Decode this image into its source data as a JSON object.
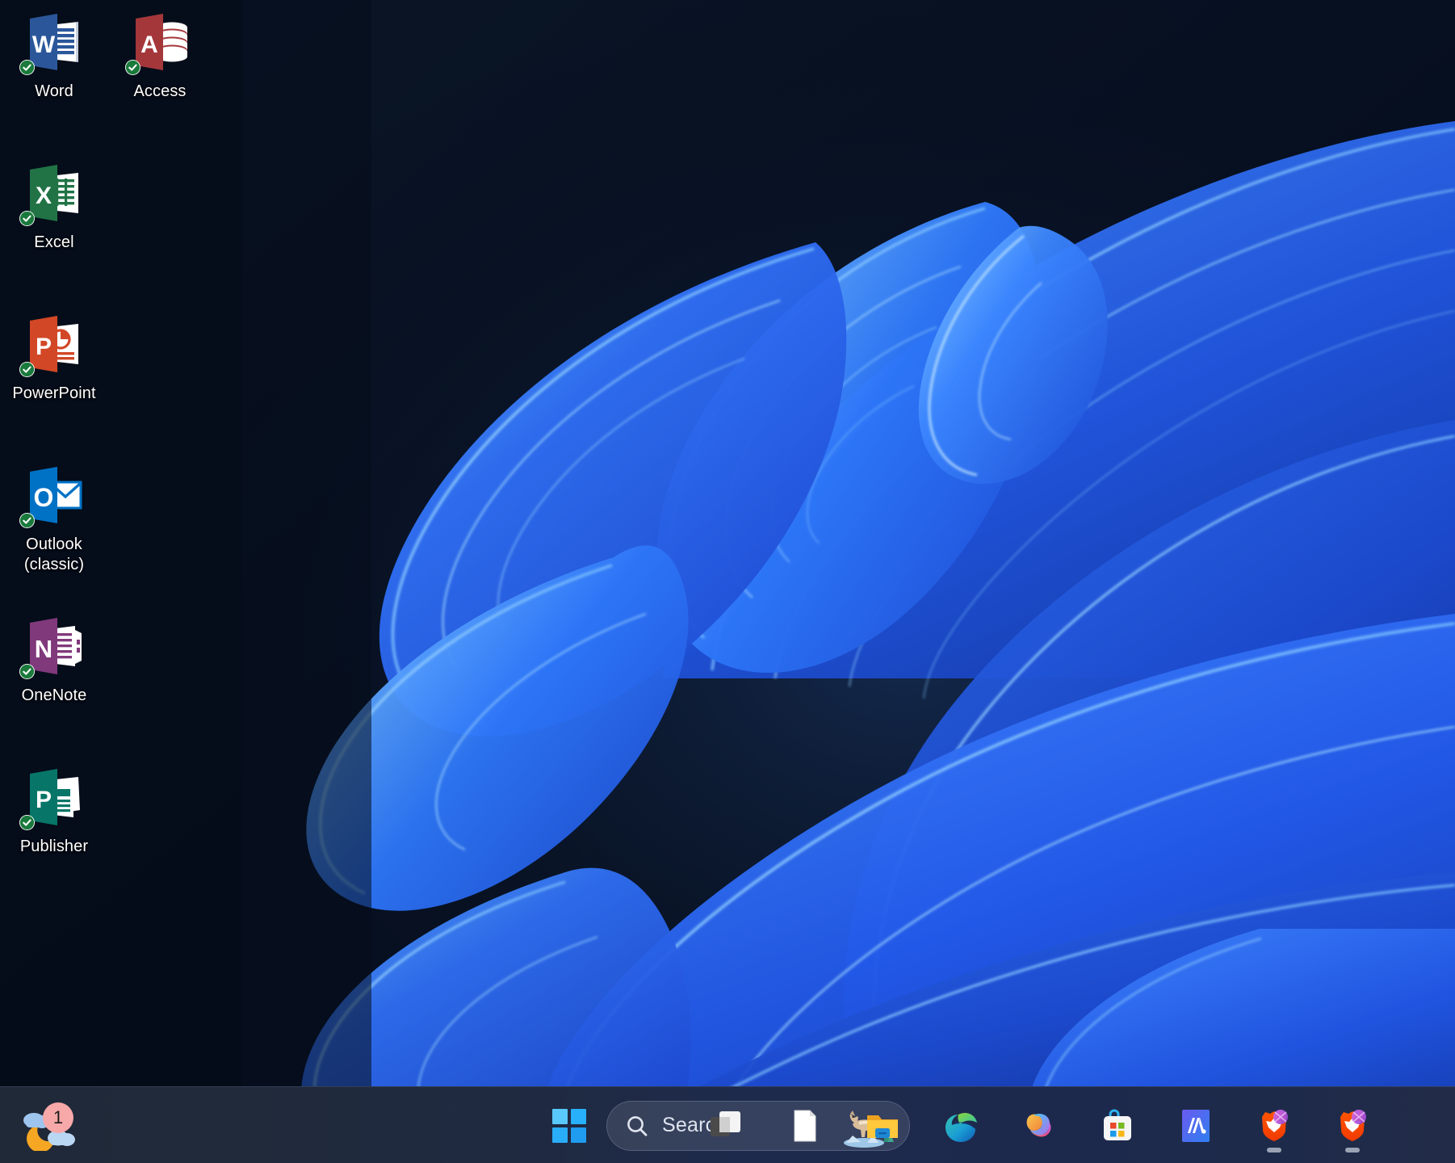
{
  "os": "Windows 11",
  "wallpaper": {
    "name": "Windows 11 Bloom",
    "background_color": "#060d1c",
    "bloom_color": "#2064f0",
    "bloom_highlight": "#6ab4ff"
  },
  "desktop": {
    "icons": [
      {
        "label": "Word",
        "app": "microsoft-word",
        "color": "#2b579a",
        "accent": "#2b579a",
        "synced": true,
        "col": 0,
        "row": 0
      },
      {
        "label": "Access",
        "app": "microsoft-access",
        "color": "#a4373a",
        "accent": "#a4373a",
        "synced": true,
        "col": 1,
        "row": 0
      },
      {
        "label": "Excel",
        "app": "microsoft-excel",
        "color": "#217346",
        "accent": "#217346",
        "synced": true,
        "col": 0,
        "row": 1
      },
      {
        "label": "PowerPoint",
        "app": "microsoft-powerpoint",
        "color": "#d24726",
        "accent": "#d24726",
        "synced": true,
        "col": 0,
        "row": 2
      },
      {
        "label": "Outlook\n(classic)",
        "app": "microsoft-outlook",
        "color": "#0072c6",
        "accent": "#0072c6",
        "synced": true,
        "col": 0,
        "row": 3
      },
      {
        "label": "OneNote",
        "app": "microsoft-onenote",
        "color": "#80397b",
        "accent": "#80397b",
        "synced": true,
        "col": 0,
        "row": 4
      },
      {
        "label": "Publisher",
        "app": "microsoft-publisher",
        "color": "#077568",
        "accent": "#077568",
        "synced": true,
        "col": 0,
        "row": 5
      }
    ]
  },
  "taskbar": {
    "background_color": "#202a3e",
    "weather": {
      "name": "weather-widget",
      "badge_count": "1",
      "badge_color": "#f7a8a8",
      "condition": "partly-cloudy-night"
    },
    "start": {
      "label": "Start",
      "name": "start-button"
    },
    "search": {
      "placeholder": "Search",
      "value": "",
      "illustration": "wolf-on-rock"
    },
    "apps": [
      {
        "label": "Task View",
        "name": "task-view",
        "running": false
      },
      {
        "label": "Notepad",
        "name": "notepad",
        "running": false
      },
      {
        "label": "File Explorer",
        "name": "file-explorer",
        "running": false
      },
      {
        "label": "Microsoft Edge",
        "name": "microsoft-edge",
        "running": false
      },
      {
        "label": "Copilot",
        "name": "copilot",
        "running": false
      },
      {
        "label": "Microsoft Store",
        "name": "microsoft-store",
        "running": false
      },
      {
        "label": "Movavi",
        "name": "movavi",
        "running": false
      },
      {
        "label": "Brave Browser",
        "name": "brave-browser",
        "running": true
      },
      {
        "label": "Brave Browser",
        "name": "brave-browser",
        "running": true
      }
    ]
  }
}
